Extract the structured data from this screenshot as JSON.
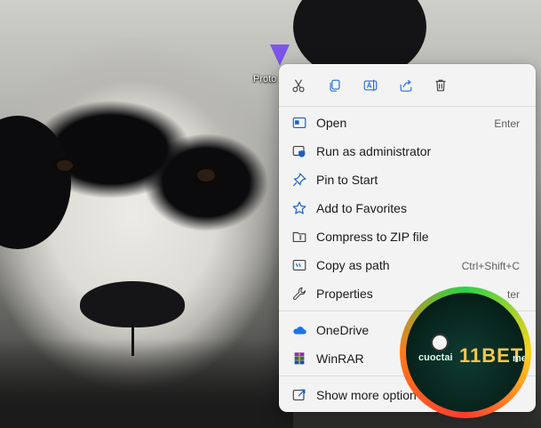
{
  "desktop": {
    "icon_label": "Proto"
  },
  "context_menu": {
    "quick_actions": [
      {
        "name": "cut",
        "icon": "scissors-icon"
      },
      {
        "name": "copy",
        "icon": "copy-icon"
      },
      {
        "name": "rename",
        "icon": "rename-icon"
      },
      {
        "name": "share",
        "icon": "share-icon"
      },
      {
        "name": "delete",
        "icon": "trash-icon"
      }
    ],
    "items": [
      {
        "label": "Open",
        "shortcut": "Enter"
      },
      {
        "label": "Run as administrator",
        "shortcut": ""
      },
      {
        "label": "Pin to Start",
        "shortcut": ""
      },
      {
        "label": "Add to Favorites",
        "shortcut": ""
      },
      {
        "label": "Compress to ZIP file",
        "shortcut": ""
      },
      {
        "label": "Copy as path",
        "shortcut": "Ctrl+Shift+C"
      },
      {
        "label": "Properties",
        "shortcut": "ter"
      },
      {
        "label": "OneDrive",
        "shortcut": ""
      },
      {
        "label": "WinRAR",
        "shortcut": ""
      },
      {
        "label": "Show more option",
        "shortcut": ""
      }
    ]
  },
  "overlay_badge": {
    "left_text": "cuoctai",
    "center_text": "11BET",
    "right_text": "me"
  },
  "colors": {
    "menu_bg": "#f3f3f3",
    "accent_blue": "#1a73e8",
    "icon_purple": "#7b56e8"
  }
}
